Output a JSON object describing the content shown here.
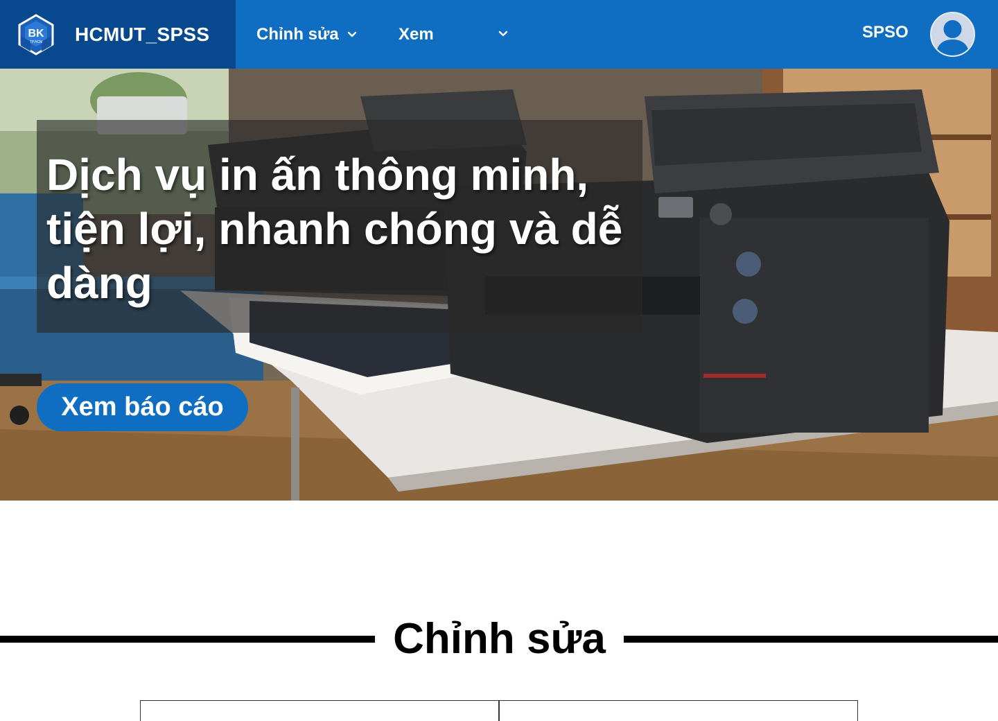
{
  "header": {
    "brand_name": "HCMUT_SPSS",
    "logo_text": "BK",
    "logo_subtext": "TP.HCM",
    "nav": [
      {
        "label": "Chỉnh sửa"
      },
      {
        "label": "Xem"
      }
    ],
    "role_label": "SPSO"
  },
  "hero": {
    "title": "Dịch vụ in ấn thông minh, tiện lợi, nhanh chóng và dễ dàng",
    "button_label": "Xem báo cáo"
  },
  "section": {
    "title": "Chỉnh sửa"
  },
  "colors": {
    "header_bg": "#0f6ec2",
    "brand_bg": "#07488f",
    "accent": "#0f6ec2"
  },
  "icons": {
    "logo": "bk-hexagon-logo",
    "dropdown": "chevron-down-icon",
    "avatar": "user-avatar-icon"
  }
}
